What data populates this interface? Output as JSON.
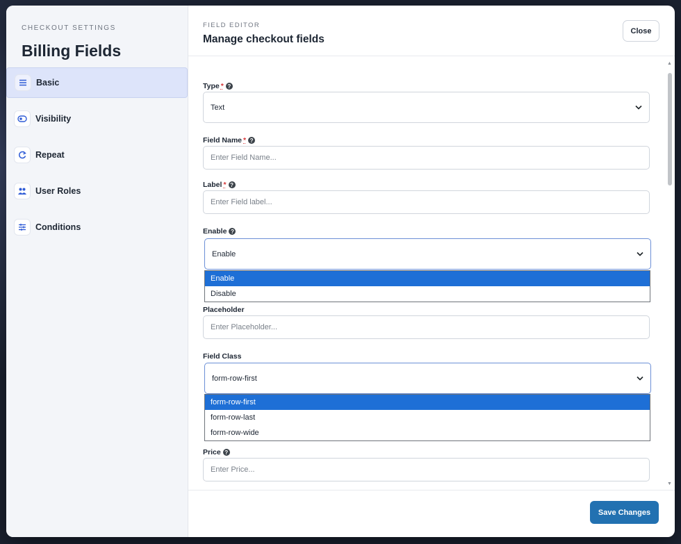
{
  "sidebar": {
    "eyebrow": "CHECKOUT SETTINGS",
    "title": "Billing Fields",
    "items": [
      {
        "label": "Basic",
        "icon": "list-icon"
      },
      {
        "label": "Visibility",
        "icon": "toggle-icon"
      },
      {
        "label": "Repeat",
        "icon": "repeat-icon"
      },
      {
        "label": "User Roles",
        "icon": "users-icon"
      },
      {
        "label": "Conditions",
        "icon": "sliders-icon"
      }
    ]
  },
  "header": {
    "eyebrow": "FIELD EDITOR",
    "title": "Manage checkout fields",
    "close_label": "Close"
  },
  "form": {
    "type": {
      "label": "Type",
      "required": "*",
      "value": "Text"
    },
    "field_name": {
      "label": "Field Name",
      "required": "*",
      "placeholder": "Enter Field Name..."
    },
    "label": {
      "label": "Label",
      "required": "*",
      "placeholder": "Enter Field label..."
    },
    "enable": {
      "label": "Enable",
      "value": "Enable",
      "options": [
        "Enable",
        "Disable"
      ]
    },
    "placeholder": {
      "label": "Placeholder",
      "placeholder": "Enter Placeholder..."
    },
    "field_class": {
      "label": "Field Class",
      "value": "form-row-first",
      "options": [
        "form-row-first",
        "form-row-last",
        "form-row-wide"
      ]
    },
    "price": {
      "label": "Price",
      "placeholder": "Enter Price..."
    }
  },
  "footer": {
    "save_label": "Save Changes"
  },
  "colors": {
    "accent": "#2271b1",
    "active_nav": "#dde4fa",
    "dropdown_selected": "#1e6fd6"
  }
}
